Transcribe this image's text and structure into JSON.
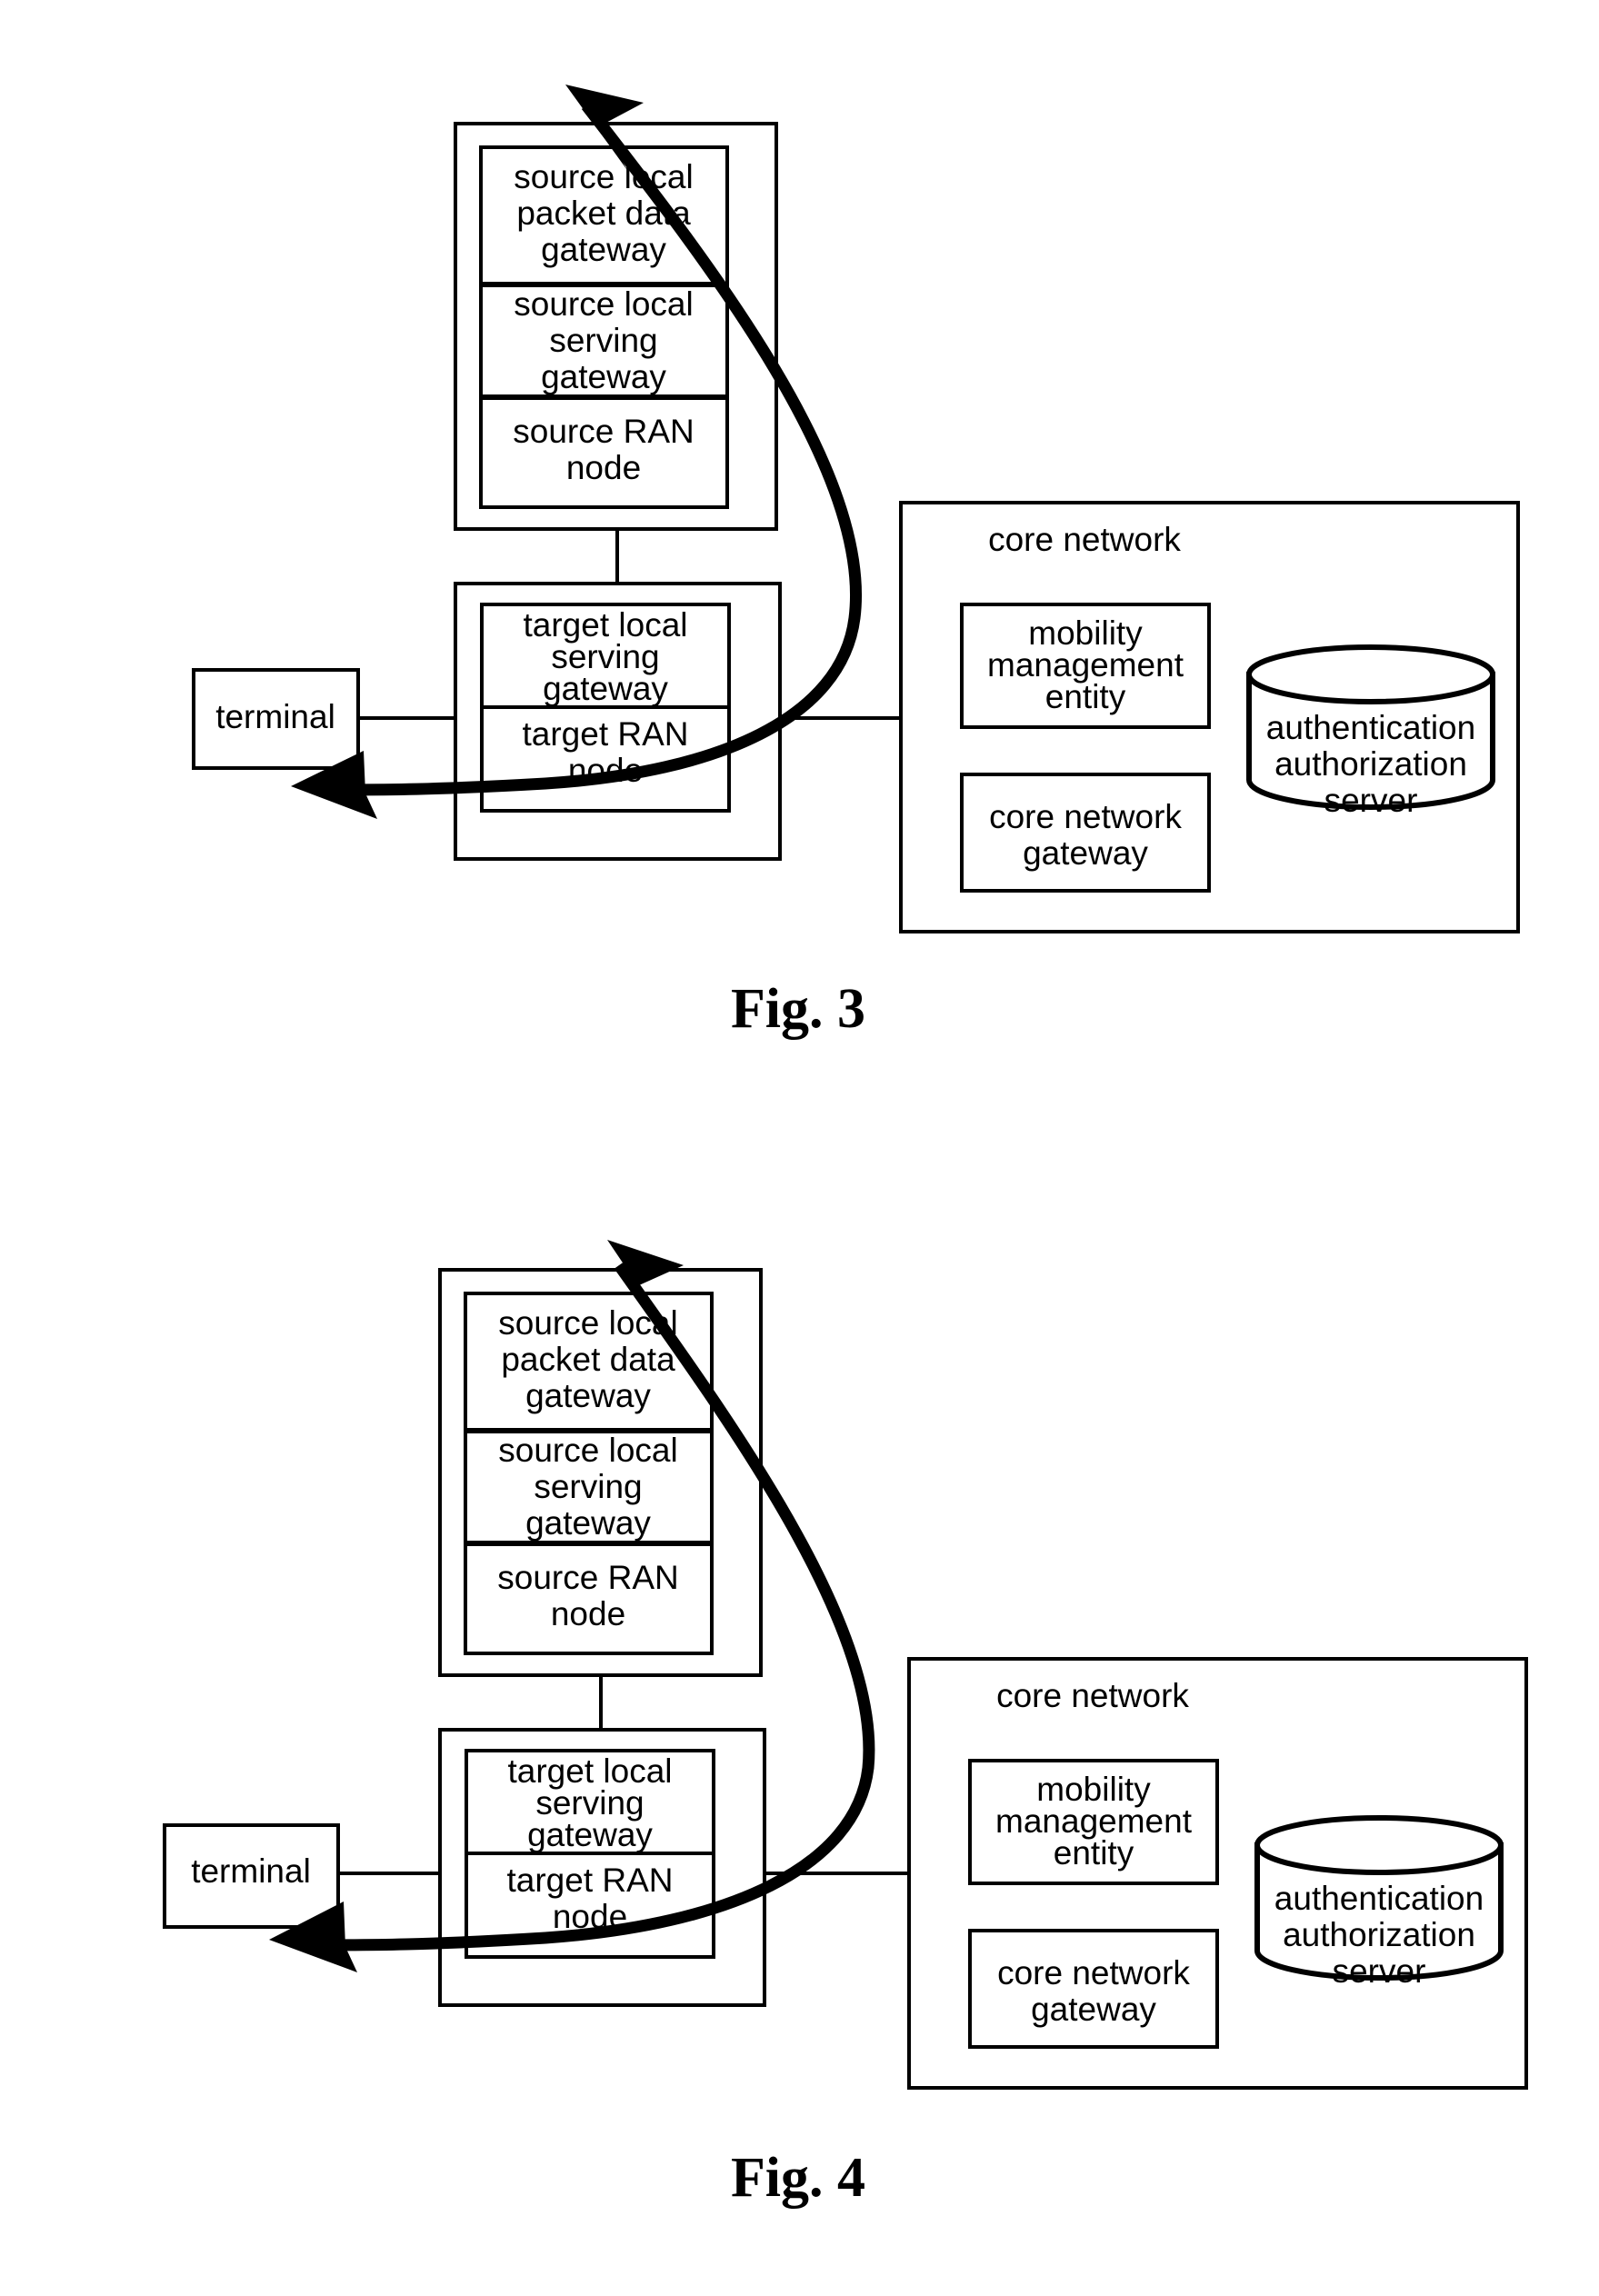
{
  "document": {
    "type": "patent-figure-sheet",
    "figures": [
      {
        "id": "fig3",
        "caption": "Fig. 3",
        "nodes": {
          "source_group": {
            "label": "",
            "children": [
              {
                "name": "source-local-packet-data-gateway",
                "lines": [
                  "source local",
                  "packet data",
                  "gateway"
                ]
              },
              {
                "name": "source-local-serving-gateway",
                "lines": [
                  "source local",
                  "serving",
                  "gateway"
                ]
              },
              {
                "name": "source-ran-node",
                "lines": [
                  "source RAN",
                  "node"
                ]
              }
            ]
          },
          "target_group": {
            "children": [
              {
                "name": "target-local-serving-gateway",
                "lines": [
                  "target local",
                  "serving",
                  "gateway"
                ]
              },
              {
                "name": "target-ran-node",
                "lines": [
                  "target RAN",
                  "node"
                ]
              }
            ]
          },
          "terminal": {
            "label": "terminal"
          },
          "core_network": {
            "label": "core network",
            "children": [
              {
                "name": "mobility-management-entity",
                "lines": [
                  "mobility",
                  "management",
                  "entity"
                ]
              },
              {
                "name": "core-network-gateway",
                "lines": [
                  "core network",
                  "gateway"
                ]
              },
              {
                "name": "authentication-authorization-server",
                "lines": [
                  "authentication",
                  "authorization",
                  "server"
                ]
              }
            ]
          }
        }
      },
      {
        "id": "fig4",
        "caption": "Fig. 4",
        "nodes": {
          "source_group": {
            "children": [
              {
                "name": "source-local-packet-data-gateway",
                "lines": [
                  "source local",
                  "packet data",
                  "gateway"
                ]
              },
              {
                "name": "source-local-serving-gateway",
                "lines": [
                  "source local",
                  "serving",
                  "gateway"
                ]
              },
              {
                "name": "source-ran-node",
                "lines": [
                  "source RAN",
                  "node"
                ]
              }
            ]
          },
          "target_group": {
            "children": [
              {
                "name": "target-local-serving-gateway",
                "lines": [
                  "target local",
                  "serving",
                  "gateway"
                ]
              },
              {
                "name": "target-ran-node",
                "lines": [
                  "target RAN",
                  "node"
                ]
              }
            ]
          },
          "terminal": {
            "label": "terminal"
          },
          "core_network": {
            "label": "core network",
            "children": [
              {
                "name": "mobility-management-entity",
                "lines": [
                  "mobility",
                  "management",
                  "entity"
                ]
              },
              {
                "name": "core-network-gateway",
                "lines": [
                  "core network",
                  "gateway"
                ]
              },
              {
                "name": "authentication-authorization-server",
                "lines": [
                  "authentication",
                  "authorization",
                  "server"
                ]
              }
            ]
          }
        }
      }
    ]
  },
  "fig3": {
    "caption": "Fig. 3",
    "source_pdg_l1": "source local",
    "source_pdg_l2": "packet data",
    "source_pdg_l3": "gateway",
    "source_sgw_l1": "source local",
    "source_sgw_l2": "serving",
    "source_sgw_l3": "gateway",
    "source_ran_l1": "source RAN",
    "source_ran_l2": "node",
    "target_sgw_l1": "target local",
    "target_sgw_l2": "serving",
    "target_sgw_l3": "gateway",
    "target_ran_l1": "target RAN",
    "target_ran_l2": "node",
    "terminal": "terminal",
    "core_network_title": "core network",
    "mme_l1": "mobility",
    "mme_l2": "management",
    "mme_l3": "entity",
    "cngw_l1": "core network",
    "cngw_l2": "gateway",
    "aaa_l1": "authentication",
    "aaa_l2": "authorization",
    "aaa_l3": "server"
  },
  "fig4": {
    "caption": "Fig. 4",
    "source_pdg_l1": "source local",
    "source_pdg_l2": "packet data",
    "source_pdg_l3": "gateway",
    "source_sgw_l1": "source local",
    "source_sgw_l2": "serving",
    "source_sgw_l3": "gateway",
    "source_ran_l1": "source RAN",
    "source_ran_l2": "node",
    "target_sgw_l1": "target local",
    "target_sgw_l2": "serving",
    "target_sgw_l3": "gateway",
    "target_ran_l1": "target RAN",
    "target_ran_l2": "node",
    "terminal": "terminal",
    "core_network_title": "core network",
    "mme_l1": "mobility",
    "mme_l2": "management",
    "mme_l3": "entity",
    "cngw_l1": "core network",
    "cngw_l2": "gateway",
    "aaa_l1": "authentication",
    "aaa_l2": "authorization",
    "aaa_l3": "server"
  },
  "colors": {
    "ink": "#000000",
    "paper": "#ffffff"
  }
}
